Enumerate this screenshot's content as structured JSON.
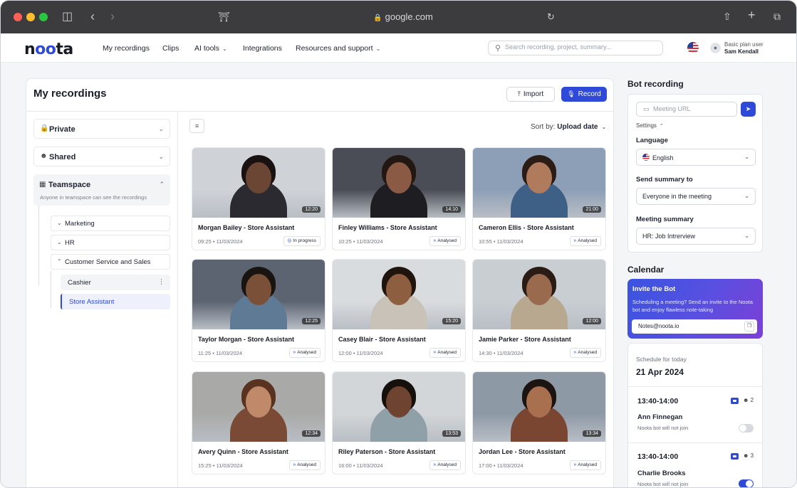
{
  "browser": {
    "url": "google.com"
  },
  "app": {
    "logo": "noota",
    "nav": [
      {
        "label": "My recordings",
        "dropdown": false
      },
      {
        "label": "Clips",
        "dropdown": false
      },
      {
        "label": "AI tools",
        "dropdown": true
      },
      {
        "label": "Integrations",
        "dropdown": false
      },
      {
        "label": "Resources and support",
        "dropdown": true
      }
    ],
    "search_placeholder": "Search recording, project, summary...",
    "user": {
      "plan": "Basic plan user",
      "name": "Sam Kendall"
    }
  },
  "main": {
    "title": "My recordings",
    "import_label": "Import",
    "record_label": "Record",
    "sort_prefix": "Sort by:",
    "sort_value": "Upload date"
  },
  "folders": {
    "private": "Private",
    "shared": "Shared",
    "teamspace": "Teamspace",
    "teamspace_desc": "Anyone in teamspace can see the recordings",
    "subfolders": [
      "Marketing",
      "HR",
      "Customer Service and Sales"
    ],
    "leaves": [
      "Cashier",
      "Store Assistant"
    ]
  },
  "recordings": [
    {
      "title": "Morgan Bailey - Store Assistant",
      "time": "09:25",
      "date": "11/03/2024",
      "duration": "12:20",
      "status": "In progress",
      "skin": "#6b4634",
      "hair": "#1a1210",
      "shirt": "#2a2a30",
      "bg": "#cfd3d8"
    },
    {
      "title": "Finley Williams - Store Assistant",
      "time": "10:25",
      "date": "11/03/2024",
      "duration": "14:10",
      "status": "Analysed",
      "skin": "#8a5a44",
      "hair": "#231712",
      "shirt": "#1e1e22",
      "bg": "#4a4d55"
    },
    {
      "title": "Cameron Ellis - Store Assistant",
      "time": "10:55",
      "date": "11/03/2024",
      "duration": "21:00",
      "status": "Analysed",
      "skin": "#b07a5c",
      "hair": "#2b1d16",
      "shirt": "#3e5f86",
      "bg": "#8d9fb6"
    },
    {
      "title": "Taylor Morgan - Store Assistant",
      "time": "11:25",
      "date": "11/03/2024",
      "duration": "12:25",
      "status": "Analysed",
      "skin": "#7a5038",
      "hair": "#1a1410",
      "shirt": "#5f7a95",
      "bg": "#5c6472"
    },
    {
      "title": "Casey Blair - Store Assistant",
      "time": "12:00",
      "date": "11/03/2024",
      "duration": "15:20",
      "status": "Analysed",
      "skin": "#8e5e40",
      "hair": "#20140d",
      "shirt": "#c9c2b8",
      "bg": "#d9dcdf"
    },
    {
      "title": "Jamie Parker - Store Assistant",
      "time": "14:30",
      "date": "11/03/2024",
      "duration": "12:00",
      "status": "Analysed",
      "skin": "#9a6a4e",
      "hair": "#2a1c15",
      "shirt": "#b8a890",
      "bg": "#c9ced3"
    },
    {
      "title": "Avery Quinn - Store Assistant",
      "time": "15:25",
      "date": "11/03/2024",
      "duration": "12:34",
      "status": "Analysed",
      "skin": "#c08a6a",
      "hair": "#5a3320",
      "shirt": "#7b4a36",
      "bg": "#a9aaa8"
    },
    {
      "title": "Riley Paterson - Store Assistant",
      "time": "16:00",
      "date": "11/03/2024",
      "duration": "13:53",
      "status": "Analysed",
      "skin": "#6e4430",
      "hair": "#15100c",
      "shirt": "#8fa0a8",
      "bg": "#d2d6d8"
    },
    {
      "title": "Jordan Lee - Store Assistant",
      "time": "17:00",
      "date": "11/03/2024",
      "duration": "13:34",
      "status": "Analysed",
      "skin": "#a8704e",
      "hair": "#1c1410",
      "shirt": "#7a4632",
      "bg": "#8e99a6"
    }
  ],
  "bot": {
    "title": "Bot recording",
    "meeting_url_placeholder": "Meeting URL",
    "settings_label": "Settings",
    "language_label": "Language",
    "language_value": "English",
    "send_summary_label": "Send summary to",
    "send_summary_value": "Everyone in the meeting",
    "meeting_summary_label": "Meeting summary",
    "meeting_summary_value": "HR: Job Intrerview"
  },
  "calendar": {
    "title": "Calendar",
    "invite_title": "Invite the Bot",
    "invite_text": "Scheduling a meeting? Send an invite to the Noota bot and enjoy flawless note-taking",
    "invite_email": "Notes@noota.io",
    "schedule_label": "Schedule for today",
    "schedule_date": "21 Apr 2024",
    "events": [
      {
        "time": "13:40-14:00",
        "attendees": "2",
        "name": "Ann Finnegan",
        "note": "Noota bot will not join",
        "bot_on": false
      },
      {
        "time": "13:40-14:00",
        "attendees": "3",
        "name": "Charlie Brooks",
        "note": "Noota bot will not join",
        "bot_on": true
      }
    ]
  },
  "colors": {
    "accent": "#2f4ad8",
    "chrome": "#3c3c3e",
    "canvas": "#f4f5f7"
  }
}
